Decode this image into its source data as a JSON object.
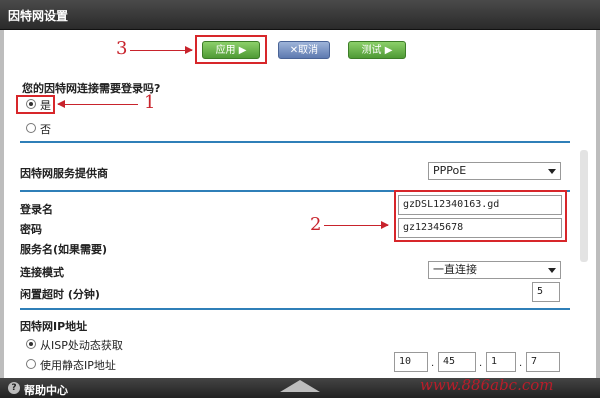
{
  "window": {
    "title": "因特网设置"
  },
  "toolbar": {
    "apply_label": "应用 ▶",
    "cancel_label": "✕取消",
    "test_label": "测试 ▶"
  },
  "annotations": {
    "step1": "1",
    "step2": "2",
    "step3": "3"
  },
  "login_required": {
    "question": "您的因特网连接需要登录吗?",
    "options": [
      {
        "label": "是",
        "selected": true
      },
      {
        "label": "否",
        "selected": false
      }
    ]
  },
  "isp": {
    "label": "因特网服务提供商",
    "value": "PPPoE"
  },
  "credentials": {
    "username_label": "登录名",
    "username_value": "gzDSL12340163.gd",
    "password_label": "密码",
    "password_value": "gz12345678",
    "service_name_label": "服务名(如果需要)"
  },
  "connection_mode": {
    "label": "连接模式",
    "value": "一直连接"
  },
  "idle_timeout": {
    "label": "闲置超时 (分钟)",
    "value": "5"
  },
  "ip_address": {
    "section_label": "因特网IP地址",
    "options": [
      {
        "label": "从ISP处动态获取",
        "selected": true
      },
      {
        "label": "使用静态IP地址",
        "selected": false
      }
    ],
    "octets": [
      "10",
      "45",
      "1",
      "7"
    ]
  },
  "footer": {
    "help_label": "帮助中心",
    "help_icon": "?",
    "watermark": "www.886abc.com"
  },
  "colors": {
    "accent_blue": "#2f7fb8",
    "highlight_red": "#d7262a",
    "button_green": "#4f9a35"
  }
}
